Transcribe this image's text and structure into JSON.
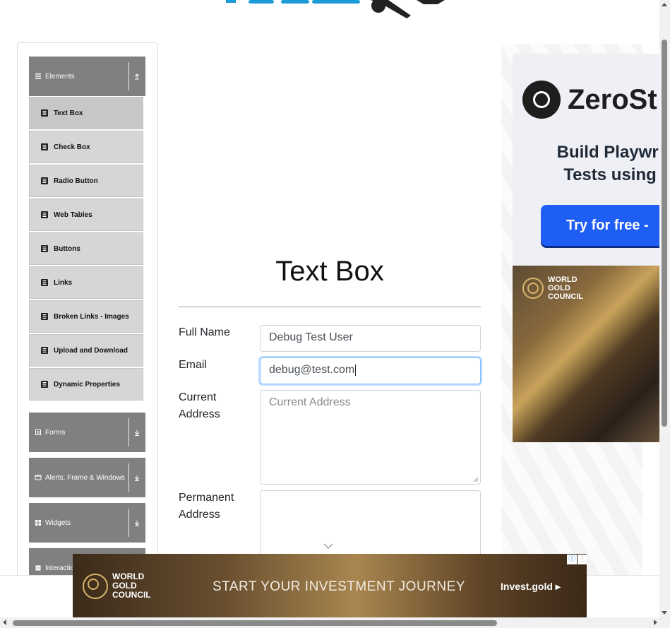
{
  "sidebar": {
    "groups": [
      {
        "label": "Elements",
        "icon": "menu-icon",
        "expanded": true
      },
      {
        "label": "Forms",
        "icon": "form-icon",
        "expanded": false
      },
      {
        "label": "Alerts, Frame & Windows",
        "icon": "window-icon",
        "expanded": false
      },
      {
        "label": "Widgets",
        "icon": "widgets-icon",
        "expanded": false
      },
      {
        "label": "Interactio",
        "icon": "interactions-icon",
        "expanded": false
      }
    ],
    "items": [
      {
        "label": "Text Box",
        "active": true
      },
      {
        "label": "Check Box"
      },
      {
        "label": "Radio Button"
      },
      {
        "label": "Web Tables"
      },
      {
        "label": "Buttons"
      },
      {
        "label": "Links"
      },
      {
        "label": "Broken Links - Images"
      },
      {
        "label": "Upload and Download"
      },
      {
        "label": "Dynamic Properties"
      }
    ]
  },
  "main": {
    "title": "Text Box",
    "fields": {
      "full_name": {
        "label": "Full Name",
        "value": "Debug Test User"
      },
      "email": {
        "label": "Email",
        "value": "debug@test.com"
      },
      "current_address": {
        "label": "Current Address",
        "placeholder": "Current Address",
        "value": ""
      },
      "permanent_address": {
        "label": "Permanent Address",
        "value": ""
      }
    }
  },
  "ads": {
    "zerostep": {
      "brand": "ZeroSt",
      "headline_line1": "Build Playwri",
      "headline_line2": "Tests using",
      "cta": "Try for free -"
    },
    "wgc_side": {
      "brand_line1": "WORLD",
      "brand_line2": "GOLD",
      "brand_line3": "COUNCIL"
    },
    "banner": {
      "brand_line1": "WORLD",
      "brand_line2": "GOLD",
      "brand_line3": "COUNCIL",
      "slogan": "START YOUR INVESTMENT JOURNEY",
      "link": "Invest.gold ▸",
      "adchoices": "ⓘ",
      "menu": "⋮"
    }
  },
  "colors": {
    "sidebar_header": "#808080",
    "sidebar_item": "#d6d6d6",
    "focus_border": "#80bdff",
    "logo_blue": "#1a9ad6"
  }
}
